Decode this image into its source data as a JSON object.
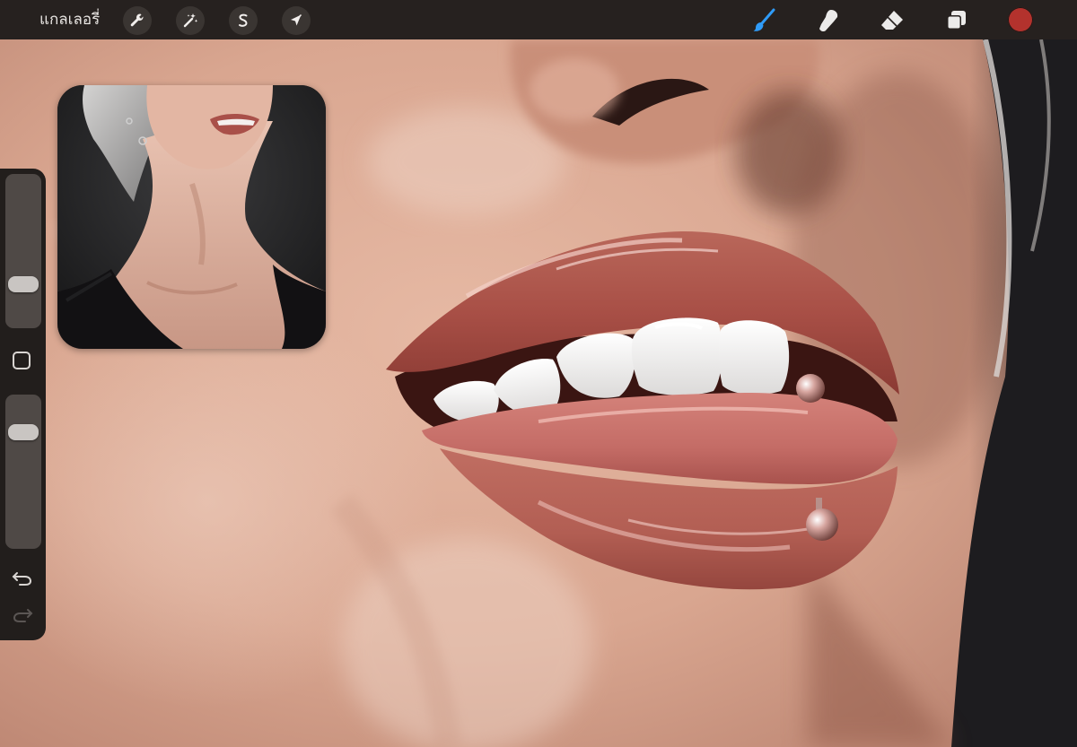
{
  "toolbar": {
    "gallery_label": "แกลเลอรี่",
    "left_tools": [
      {
        "name": "actions",
        "icon": "wrench-icon"
      },
      {
        "name": "adjustments",
        "icon": "magic-wand-icon"
      },
      {
        "name": "selection",
        "icon": "selection-s-icon"
      },
      {
        "name": "transform",
        "icon": "arrow-cursor-icon"
      }
    ],
    "right_tools": [
      {
        "name": "brush",
        "icon": "brush-icon",
        "active": true,
        "color": "#2f9bf7"
      },
      {
        "name": "smudge",
        "icon": "smudge-finger-icon",
        "active": false
      },
      {
        "name": "eraser",
        "icon": "eraser-icon",
        "active": false
      },
      {
        "name": "layers",
        "icon": "layers-icon",
        "active": false
      }
    ],
    "current_color": "#b3322d"
  },
  "sidebar": {
    "brush_size_level": 0.25,
    "opacity_level": 0.8,
    "modify_button_icon": "square-icon",
    "undo_icon": "undo-arrow-icon",
    "redo_icon": "redo-arrow-icon"
  },
  "reference": {
    "subject": "reference-photo"
  },
  "canvas": {
    "subject": "painting-lips-piercing"
  }
}
